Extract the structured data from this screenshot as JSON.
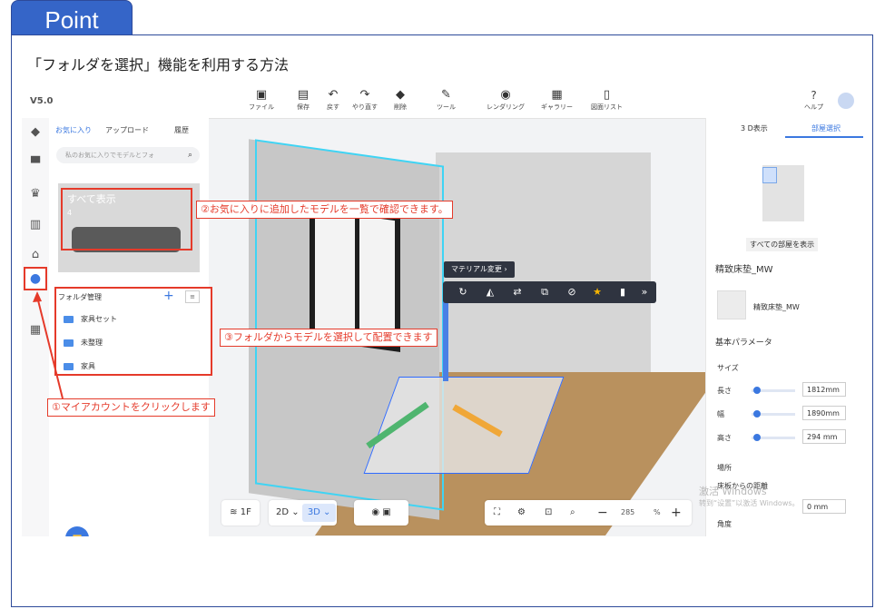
{
  "header": {
    "tab_label": "Point",
    "caption": "「フォルダを選択」機能を利用する方法"
  },
  "app": {
    "version": "V5.0",
    "toolbar": [
      {
        "label": "ファイル",
        "icon": "file-icon"
      },
      {
        "label": "保存",
        "icon": "save-icon"
      },
      {
        "label": "戻す",
        "icon": "undo-icon"
      },
      {
        "label": "やり直す",
        "icon": "redo-icon"
      },
      {
        "label": "削除",
        "icon": "eraser-icon"
      },
      {
        "label": "ツール",
        "icon": "wrench-icon"
      },
      {
        "label": "レンダリング",
        "icon": "camera-icon"
      },
      {
        "label": "ギャラリー",
        "icon": "gallery-icon"
      },
      {
        "label": "図面リスト",
        "icon": "document-icon"
      }
    ],
    "help_label": "ヘルプ",
    "left_panel": {
      "tabs": [
        "お気に入り",
        "アップロード",
        "履歴"
      ],
      "search_placeholder": "私のお気に入りでモデルとフォ",
      "thumb_title": "すべて表示",
      "thumb_count": "4",
      "folder_header": "フォルダ管理",
      "folders": [
        "家具セット",
        "未整理",
        "家具"
      ]
    },
    "scene": {
      "material_tip": "マテリアル変更",
      "chevron": "›"
    },
    "bottom": {
      "floor": "1F",
      "mode_2d": "2D",
      "mode_3d": "3D",
      "zoom": "285",
      "zoom_unit": "%"
    },
    "right_panel": {
      "tabs": [
        "3 D表示",
        "部屋選択"
      ],
      "all_rooms": "すべての部屋を表示",
      "product_title": "精致床垫_MW",
      "product_name": "精致床垫_MW",
      "section_params": "基本パラメータ",
      "section_size": "サイズ",
      "length_label": "長さ",
      "length_val": "1812mm",
      "width_label": "幅",
      "width_val": "1890mm",
      "height_label": "高さ",
      "height_val": "294  mm",
      "section_place": "場所",
      "floor_dist_label": "床板からの距離",
      "floor_dist_val": "0   mm",
      "angle_label": "角度"
    },
    "watermark": [
      "激活 Windows",
      "转到“设置”以激活 Windows。"
    ]
  },
  "annotations": {
    "a1": "①マイアカウントをクリックします",
    "a2": "②お気に入りに追加したモデルを一覧で確認できます。",
    "a3": "③フォルダからモデルを選択して配置できます"
  },
  "colors": {
    "accent": "#3b78e0",
    "annotation": "#e53a2a",
    "tab": "#3565c8"
  }
}
